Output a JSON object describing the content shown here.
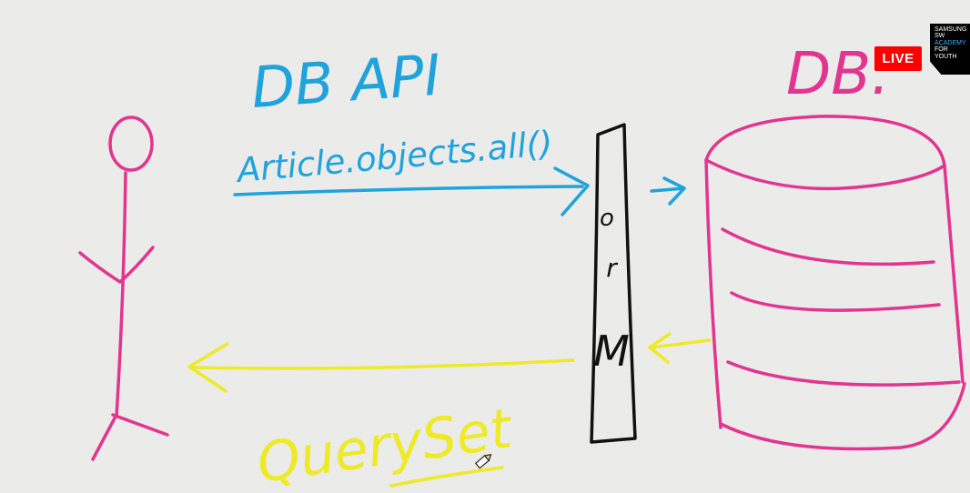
{
  "whiteboard": {
    "title_api": "DB API",
    "code_call": "Article.objects.all()",
    "orm_letters": [
      "o",
      "r",
      "M"
    ],
    "db_label": "DB.",
    "return_label": "QuerySet"
  },
  "overlay": {
    "live_label": "LIVE",
    "logo_lines": [
      "SAMSUNG",
      "SW",
      "ACADEMY",
      "FOR",
      "YOUTH"
    ]
  },
  "colors": {
    "background": "#ebebea",
    "blue_ink": "#1fa3dc",
    "magenta_ink": "#e2358f",
    "yellow_ink": "#eeea28",
    "black_ink": "#111111",
    "live_red": "#ff0000"
  },
  "cursor_icon": "pencil-cursor-icon"
}
